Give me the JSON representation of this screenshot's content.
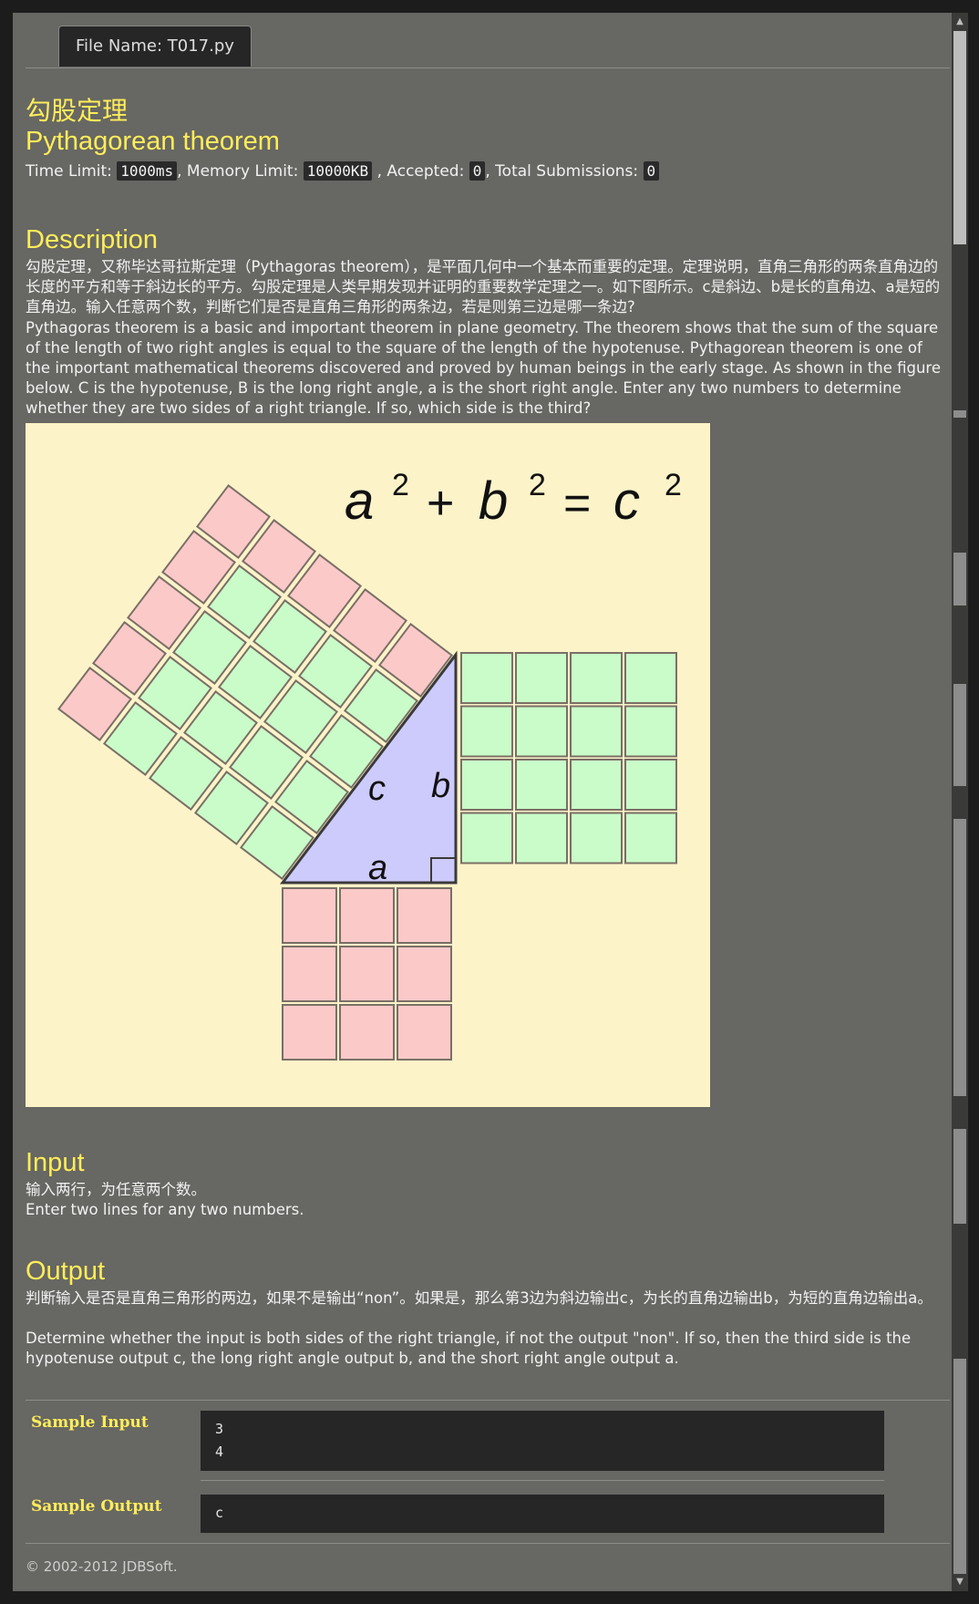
{
  "tab": {
    "prefix": "File Name:",
    "filename": "T017.py"
  },
  "title": {
    "cn": "勾股定理",
    "en": "Pythagorean theorem"
  },
  "limits": {
    "time_label": "Time Limit:",
    "time_value": "1000ms",
    "memory_label": ", Memory Limit:",
    "memory_value": "10000KB",
    "accepted_label": ", Accepted:",
    "accepted_value": "0",
    "submissions_label": ", Total Submissions:",
    "submissions_value": "0"
  },
  "description": {
    "heading": "Description",
    "cn": "勾股定理，又称毕达哥拉斯定理（Pythagoras theorem），是平面几何中一个基本而重要的定理。定理说明，直角三角形的两条直角边的长度的平方和等于斜边长的平方。勾股定理是人类早期发现并证明的重要数学定理之一。如下图所示。c是斜边、b是长的直角边、a是短的直角边。输入任意两个数，判断它们是否是直角三角形的两条边，若是则第三边是哪一条边?",
    "en": "Pythagoras theorem is a basic and important theorem in plane geometry. The theorem shows that the sum of the square of the length of two right angles is equal to the square of the length of the hypotenuse. Pythagorean theorem is one of the important mathematical theorems discovered and proved by human beings in the early stage. As shown in the figure below. C is the hypotenuse, B is the long right angle, a is the short right angle. Enter any two numbers to determine whether they are two sides of a right triangle. If so, which side is the third?"
  },
  "figure": {
    "a": "a",
    "b": "b",
    "c": "c",
    "exp": "2",
    "plus": "+",
    "eq": "=",
    "colors": {
      "bg": "#fdf3c9",
      "pink": "#fcc9c9",
      "green": "#c9fcc9",
      "triangle": "#cdcbfc"
    }
  },
  "input": {
    "heading": "Input",
    "cn": "输入两行，为任意两个数。",
    "en": "Enter two lines for any two numbers."
  },
  "output": {
    "heading": "Output",
    "cn": "判断输入是否是直角三角形的两边，如果不是输出“non”。如果是，那么第3边为斜边输出c，为长的直角边输出b，为短的直角边输出a。",
    "en": "Determine whether the input is both sides of the right triangle, if not the output \"non\". If so, then the third side is the hypotenuse output c, the long right angle output b, and the short right angle output a."
  },
  "samples": {
    "input_label": "Sample Input",
    "input_value": "3\n4",
    "output_label": "Sample Output",
    "output_value": "c"
  },
  "footer": "© 2002-2012  JDBSoft."
}
